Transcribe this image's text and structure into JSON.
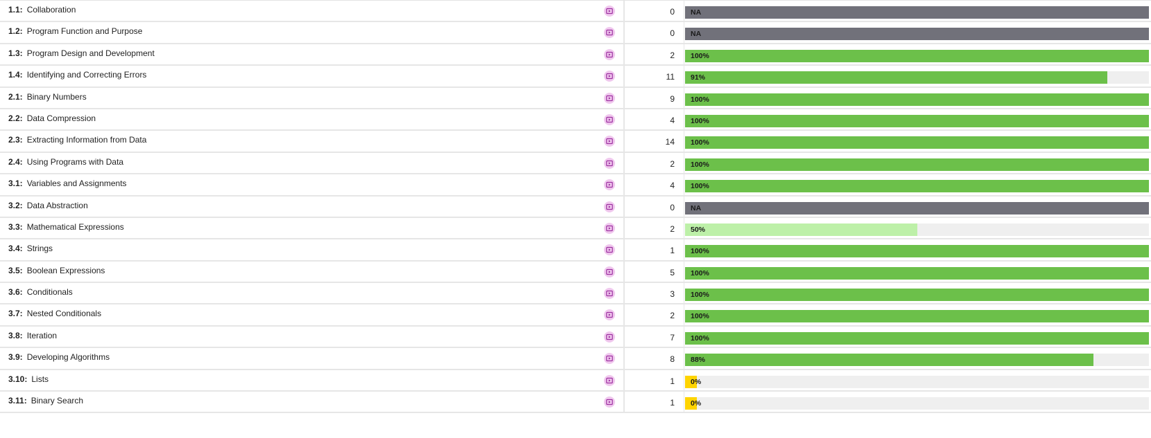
{
  "colors": {
    "na": "#71717a",
    "full": "#6cc04a",
    "partial_high": "#6cc04a",
    "partial_low": "#bdf0a8",
    "zero": "#ffd400",
    "track": "#efefef",
    "video_icon_bg": "#f0c8ee",
    "video_icon_fg": "#9c2fa0"
  },
  "rows": [
    {
      "code": "1.1:",
      "title": "Collaboration",
      "count": "0",
      "score_text": "NA",
      "fraction": 1.0,
      "status": "na"
    },
    {
      "code": "1.2:",
      "title": "Program Function and Purpose",
      "count": "0",
      "score_text": "NA",
      "fraction": 1.0,
      "status": "na"
    },
    {
      "code": "1.3:",
      "title": "Program Design and Development",
      "count": "2",
      "score_text": "100%",
      "fraction": 1.0,
      "status": "full"
    },
    {
      "code": "1.4:",
      "title": "Identifying and Correcting Errors",
      "count": "11",
      "score_text": "91%",
      "fraction": 0.91,
      "status": "partial_high"
    },
    {
      "code": "2.1:",
      "title": "Binary Numbers",
      "count": "9",
      "score_text": "100%",
      "fraction": 1.0,
      "status": "full"
    },
    {
      "code": "2.2:",
      "title": "Data Compression",
      "count": "4",
      "score_text": "100%",
      "fraction": 1.0,
      "status": "full"
    },
    {
      "code": "2.3:",
      "title": "Extracting Information from Data",
      "count": "14",
      "score_text": "100%",
      "fraction": 1.0,
      "status": "full"
    },
    {
      "code": "2.4:",
      "title": "Using Programs with Data",
      "count": "2",
      "score_text": "100%",
      "fraction": 1.0,
      "status": "full"
    },
    {
      "code": "3.1:",
      "title": "Variables and Assignments",
      "count": "4",
      "score_text": "100%",
      "fraction": 1.0,
      "status": "full"
    },
    {
      "code": "3.2:",
      "title": "Data Abstraction",
      "count": "0",
      "score_text": "NA",
      "fraction": 1.0,
      "status": "na"
    },
    {
      "code": "3.3:",
      "title": "Mathematical Expressions",
      "count": "2",
      "score_text": "50%",
      "fraction": 0.5,
      "status": "partial_low"
    },
    {
      "code": "3.4:",
      "title": "Strings",
      "count": "1",
      "score_text": "100%",
      "fraction": 1.0,
      "status": "full"
    },
    {
      "code": "3.5:",
      "title": "Boolean Expressions",
      "count": "5",
      "score_text": "100%",
      "fraction": 1.0,
      "status": "full"
    },
    {
      "code": "3.6:",
      "title": "Conditionals",
      "count": "3",
      "score_text": "100%",
      "fraction": 1.0,
      "status": "full"
    },
    {
      "code": "3.7:",
      "title": "Nested Conditionals",
      "count": "2",
      "score_text": "100%",
      "fraction": 1.0,
      "status": "full"
    },
    {
      "code": "3.8:",
      "title": "Iteration",
      "count": "7",
      "score_text": "100%",
      "fraction": 1.0,
      "status": "full"
    },
    {
      "code": "3.9:",
      "title": "Developing Algorithms",
      "count": "8",
      "score_text": "88%",
      "fraction": 0.88,
      "status": "partial_high"
    },
    {
      "code": "3.10:",
      "title": "Lists",
      "count": "1",
      "score_text": "0%",
      "fraction": 0.025,
      "status": "zero"
    },
    {
      "code": "3.11:",
      "title": "Binary Search",
      "count": "1",
      "score_text": "0%",
      "fraction": 0.025,
      "status": "zero"
    }
  ],
  "icons": {
    "video": "video-play-icon"
  }
}
